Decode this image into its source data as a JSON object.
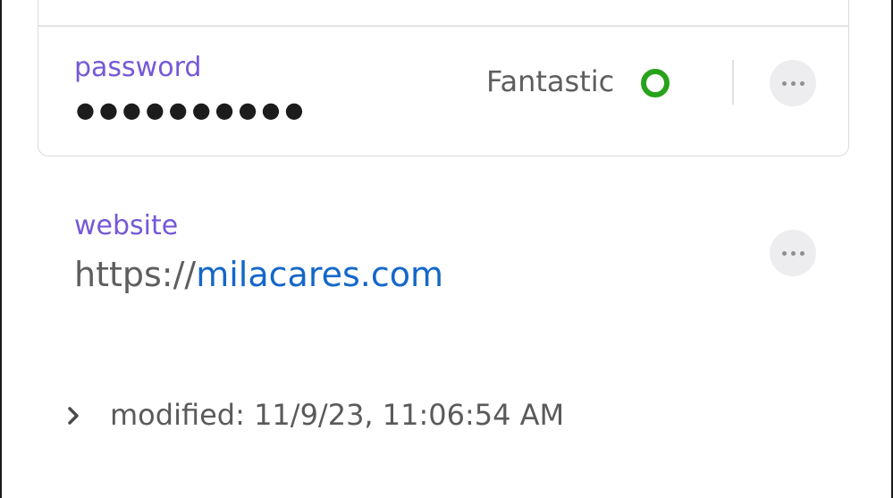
{
  "password_field": {
    "label": "password",
    "masked_value": "●●●●●●●●●●",
    "strength": "Fantastic",
    "strength_color": "#26a31a",
    "more_icon": "ellipsis-icon"
  },
  "website_field": {
    "label": "website",
    "scheme": "https://",
    "host": "milacares.com",
    "more_icon": "ellipsis-icon"
  },
  "footer": {
    "modified_text": "modified: 11/9/23, 11:06:54 AM",
    "expand_icon": "chevron-right-icon"
  },
  "colors": {
    "label": "#7558d6",
    "link": "#1467c9",
    "strength_good": "#26a31a"
  }
}
